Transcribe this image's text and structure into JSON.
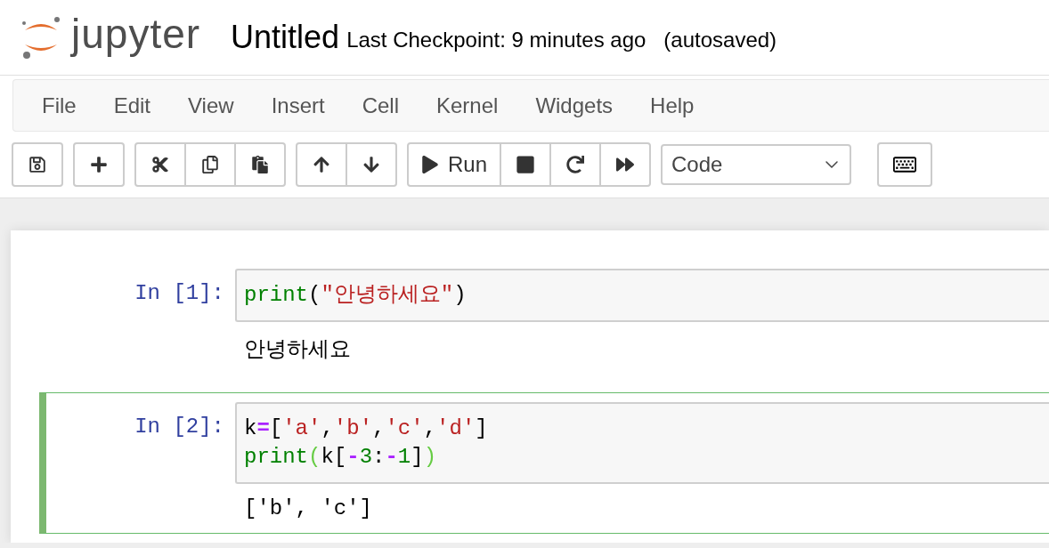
{
  "header": {
    "logo_text": "jupyter",
    "notebook_name": "Untitled",
    "checkpoint": "Last Checkpoint: 9 minutes ago",
    "autosave": "(autosaved)"
  },
  "menu": [
    "File",
    "Edit",
    "View",
    "Insert",
    "Cell",
    "Kernel",
    "Widgets",
    "Help"
  ],
  "toolbar": {
    "groups": [
      {
        "buttons": [
          {
            "kind": "save"
          }
        ]
      },
      {
        "buttons": [
          {
            "kind": "plus"
          }
        ]
      },
      {
        "buttons": [
          {
            "kind": "cut"
          },
          {
            "kind": "copy"
          },
          {
            "kind": "paste"
          }
        ]
      },
      {
        "buttons": [
          {
            "kind": "up"
          },
          {
            "kind": "down"
          }
        ]
      },
      {
        "buttons": [
          {
            "kind": "run",
            "label": "Run"
          },
          {
            "kind": "stop"
          },
          {
            "kind": "restart"
          },
          {
            "kind": "forward"
          }
        ]
      }
    ],
    "cell_type": "Code"
  },
  "cells": [
    {
      "prompt": "In [1]:",
      "selected": false,
      "code": [
        [
          {
            "kind": "builtin",
            "text": "print"
          },
          {
            "kind": "punct",
            "text": "("
          },
          {
            "kind": "string",
            "text": "\"안녕하세요\""
          },
          {
            "kind": "punct",
            "text": ")"
          }
        ]
      ],
      "output": "안녕하세요"
    },
    {
      "prompt": "In [2]:",
      "selected": true,
      "code": [
        [
          {
            "kind": "name",
            "text": "k"
          },
          {
            "kind": "operator",
            "text": "="
          },
          {
            "kind": "punct",
            "text": "["
          },
          {
            "kind": "string",
            "text": "'a'"
          },
          {
            "kind": "punct",
            "text": ","
          },
          {
            "kind": "string",
            "text": "'b'"
          },
          {
            "kind": "punct",
            "text": ","
          },
          {
            "kind": "string",
            "text": "'c'"
          },
          {
            "kind": "punct",
            "text": ","
          },
          {
            "kind": "string",
            "text": "'d'"
          },
          {
            "kind": "punct",
            "text": "]"
          }
        ],
        [
          {
            "kind": "builtin",
            "text": "print"
          },
          {
            "kind": "bracket",
            "text": "("
          },
          {
            "kind": "name",
            "text": "k"
          },
          {
            "kind": "punct",
            "text": "["
          },
          {
            "kind": "operator",
            "text": "-"
          },
          {
            "kind": "number",
            "text": "3"
          },
          {
            "kind": "punct",
            "text": ":"
          },
          {
            "kind": "operator",
            "text": "-"
          },
          {
            "kind": "number",
            "text": "1"
          },
          {
            "kind": "punct",
            "text": "]"
          },
          {
            "kind": "bracket",
            "text": ")"
          }
        ]
      ],
      "output": "['b', 'c']"
    }
  ]
}
